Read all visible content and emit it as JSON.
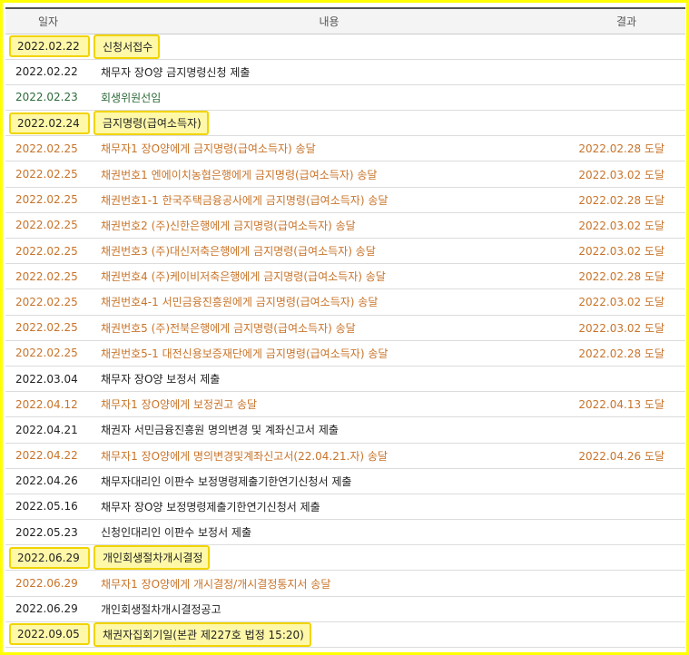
{
  "header": {
    "date": "일자",
    "content": "내용",
    "result": "결과"
  },
  "colors": {
    "frame": "#ffff00",
    "highlight_fill": "#fff8a8",
    "highlight_border": "#f1d400",
    "orange": "#c8742a",
    "green": "#2e6b3a",
    "black": "#222222"
  },
  "rows": [
    {
      "date": "2022.02.22",
      "content": "신청서접수",
      "result": ""
    },
    {
      "date": "2022.02.22",
      "content": "채무자 장O양 금지명령신청 제출",
      "result": ""
    },
    {
      "date": "2022.02.23",
      "content": "회생위원선임",
      "result": ""
    },
    {
      "date": "2022.02.24",
      "content": "금지명령(급여소득자)",
      "result": ""
    },
    {
      "date": "2022.02.25",
      "content": "채무자1 장O양에게 금지명령(급여소득자) 송달",
      "result": "2022.02.28 도달"
    },
    {
      "date": "2022.02.25",
      "content": "채권번호1 엔에이치농협은행에게 금지명령(급여소득자) 송달",
      "result": "2022.03.02 도달"
    },
    {
      "date": "2022.02.25",
      "content": "채권번호1-1 한국주택금융공사에게 금지명령(급여소득자) 송달",
      "result": "2022.02.28 도달"
    },
    {
      "date": "2022.02.25",
      "content": "채권번호2 (주)신한은행에게 금지명령(급여소득자) 송달",
      "result": "2022.03.02 도달"
    },
    {
      "date": "2022.02.25",
      "content": "채권번호3 (주)대신저축은행에게 금지명령(급여소득자) 송달",
      "result": "2022.03.02 도달"
    },
    {
      "date": "2022.02.25",
      "content": "채권번호4 (주)케이비저축은행에게 금지명령(급여소득자) 송달",
      "result": "2022.02.28 도달"
    },
    {
      "date": "2022.02.25",
      "content": "채권번호4-1 서민금융진흥원에게 금지명령(급여소득자) 송달",
      "result": "2022.03.02 도달"
    },
    {
      "date": "2022.02.25",
      "content": "채권번호5 (주)전북은행에게 금지명령(급여소득자) 송달",
      "result": "2022.03.02 도달"
    },
    {
      "date": "2022.02.25",
      "content": "채권번호5-1 대전신용보증재단에게 금지명령(급여소득자) 송달",
      "result": "2022.02.28 도달"
    },
    {
      "date": "2022.03.04",
      "content": "채무자 장O양 보정서 제출",
      "result": ""
    },
    {
      "date": "2022.04.12",
      "content": "채무자1 장O양에게 보정권고 송달",
      "result": "2022.04.13 도달"
    },
    {
      "date": "2022.04.21",
      "content": "채권자 서민금융진흥원 명의변경 및 계좌신고서 제출",
      "result": ""
    },
    {
      "date": "2022.04.22",
      "content": "채무자1 장O양에게 명의변경및계좌신고서(22.04.21.자) 송달",
      "result": "2022.04.26 도달"
    },
    {
      "date": "2022.04.26",
      "content": "채무자대리인 이판수 보정명령제출기한연기신청서 제출",
      "result": ""
    },
    {
      "date": "2022.05.16",
      "content": "채무자 장O양 보정명령제출기한연기신청서 제출",
      "result": ""
    },
    {
      "date": "2022.05.23",
      "content": "신청인대리인 이판수 보정서 제출",
      "result": ""
    },
    {
      "date": "2022.06.29",
      "content": "개인회생절차개시결정",
      "result": ""
    },
    {
      "date": "2022.06.29",
      "content": "채무자1 장O양에게 개시결정/개시결정통지서 송달",
      "result": ""
    },
    {
      "date": "2022.06.29",
      "content": "개인회생절차개시결정공고",
      "result": ""
    },
    {
      "date": "2022.09.05",
      "content": "채권자집회기일(본관 제227호 법정 15:20)",
      "result": ""
    }
  ]
}
